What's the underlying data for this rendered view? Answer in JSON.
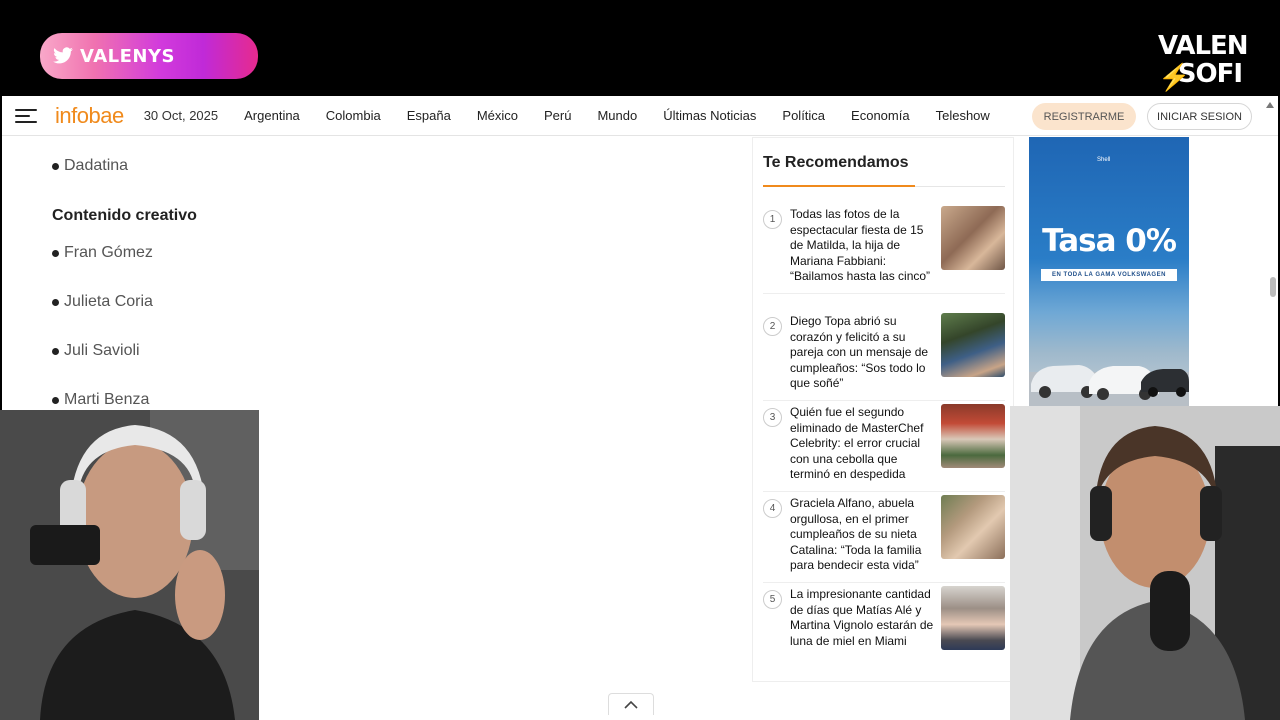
{
  "overlay": {
    "twitter_handle": "VALENYS",
    "logo_line1": "VALEN",
    "logo_line2": "SOFI"
  },
  "navbar": {
    "brand": "infobae",
    "date": "30 Oct, 2025",
    "links": [
      "Argentina",
      "Colombia",
      "España",
      "México",
      "Perú",
      "Mundo",
      "Últimas Noticias",
      "Política",
      "Economía",
      "Teleshow"
    ],
    "register": "REGISTRARME",
    "login": "INICIAR SESION"
  },
  "article": {
    "top_item": "Dadatina",
    "section_title": "Contenido creativo",
    "items": [
      "Fran Gómez",
      "Julieta Coria",
      "Juli Savioli",
      "Marti Benza"
    ]
  },
  "sidebar": {
    "title": "Te Recomendamos",
    "items": [
      {
        "num": "1",
        "text": "Todas las fotos de la espectacular fiesta de 15 de Matilda, la hija de Mariana Fabbiani: “Bailamos hasta las cinco”"
      },
      {
        "num": "2",
        "text": "Diego Topa abrió su corazón y felicitó a su pareja con un mensaje de cumpleaños: “Sos todo lo que soñé”"
      },
      {
        "num": "3",
        "text": "Quién fue el segundo eliminado de MasterChef Celebrity: el error crucial con una cebolla que terminó en despedida"
      },
      {
        "num": "4",
        "text": "Graciela Alfano, abuela orgullosa, en el primer cumpleaños de su nieta Catalina: “Toda la familia para bendecir esta vida”"
      },
      {
        "num": "5",
        "text": "La impresionante cantidad de días que Matías Alé y Martina Vignolo estarán de luna de miel en Miami"
      }
    ]
  },
  "ad": {
    "tag": "Shell",
    "headline": "Tasa 0%",
    "subline": "EN TODA LA GAMA VOLKSWAGEN"
  },
  "colors": {
    "brand": "#f08a1c",
    "register_bg": "#fbe4cd",
    "ad_blue": "#1f66b4"
  }
}
